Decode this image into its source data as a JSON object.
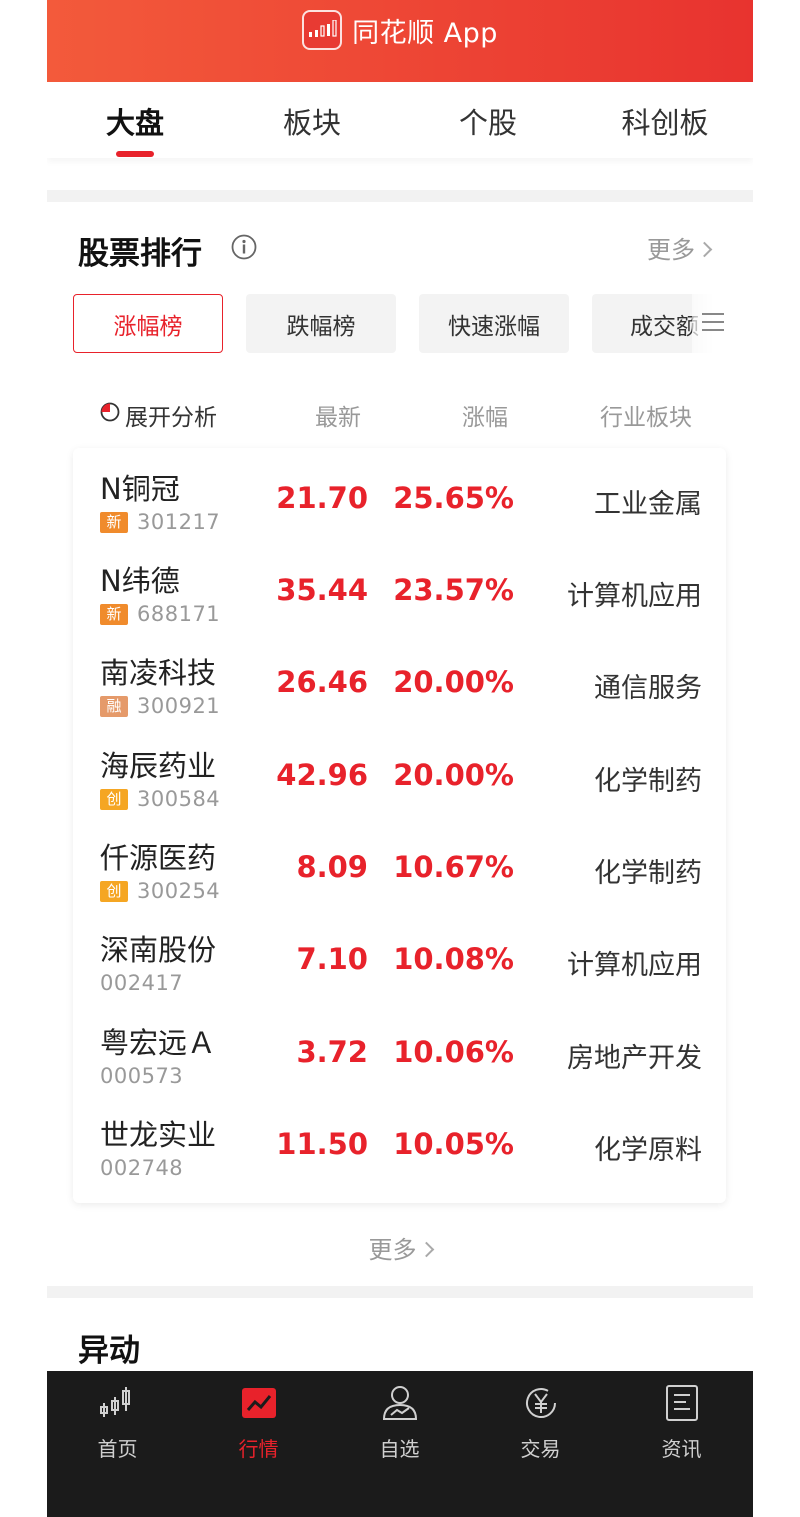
{
  "header": {
    "app_title": "同花顺 App"
  },
  "top_tabs": [
    {
      "label": "大盘",
      "active": true
    },
    {
      "label": "板块",
      "active": false
    },
    {
      "label": "个股",
      "active": false
    },
    {
      "label": "科创板",
      "active": false
    }
  ],
  "ranking": {
    "title": "股票排行",
    "more_label": "更多",
    "tabs": [
      {
        "label": "涨幅榜",
        "active": true
      },
      {
        "label": "跌幅榜",
        "active": false
      },
      {
        "label": "快速涨幅",
        "active": false
      },
      {
        "label": "成交额",
        "active": false
      }
    ],
    "columns": {
      "expand": "展开分析",
      "latest": "最新",
      "change": "涨幅",
      "industry": "行业板块"
    },
    "rows": [
      {
        "name": "N铜冠",
        "badge": "新",
        "code": "301217",
        "price": "21.70",
        "change": "25.65%",
        "industry": "工业金属"
      },
      {
        "name": "N纬德",
        "badge": "新",
        "code": "688171",
        "price": "35.44",
        "change": "23.57%",
        "industry": "计算机应用"
      },
      {
        "name": "南凌科技",
        "badge": "融",
        "code": "300921",
        "price": "26.46",
        "change": "20.00%",
        "industry": "通信服务"
      },
      {
        "name": "海辰药业",
        "badge": "创",
        "code": "300584",
        "price": "42.96",
        "change": "20.00%",
        "industry": "化学制药"
      },
      {
        "name": "仟源医药",
        "badge": "创",
        "code": "300254",
        "price": "8.09",
        "change": "10.67%",
        "industry": "化学制药"
      },
      {
        "name": "深南股份",
        "badge": "",
        "code": "002417",
        "price": "7.10",
        "change": "10.08%",
        "industry": "计算机应用"
      },
      {
        "name": "粤宏远Ａ",
        "badge": "",
        "code": "000573",
        "price": "3.72",
        "change": "10.06%",
        "industry": "房地产开发"
      },
      {
        "name": "世龙实业",
        "badge": "",
        "code": "002748",
        "price": "11.50",
        "change": "10.05%",
        "industry": "化学原料"
      }
    ],
    "more_bottom_label": "更多"
  },
  "movement": {
    "title": "异动"
  },
  "bottom_nav": [
    {
      "label": "首页",
      "icon": "candlestick-icon",
      "active": false
    },
    {
      "label": "行情",
      "icon": "market-chart-icon",
      "active": true
    },
    {
      "label": "自选",
      "icon": "watchlist-person-icon",
      "active": false
    },
    {
      "label": "交易",
      "icon": "yen-coin-icon",
      "active": false
    },
    {
      "label": "资讯",
      "icon": "news-document-icon",
      "active": false
    }
  ],
  "colors": {
    "brand_red": "#e8222b",
    "badge_new": "#f08b2c",
    "badge_margin": "#e59a6a",
    "badge_gem": "#f5a623",
    "nav_bg": "#1b1b1b"
  }
}
